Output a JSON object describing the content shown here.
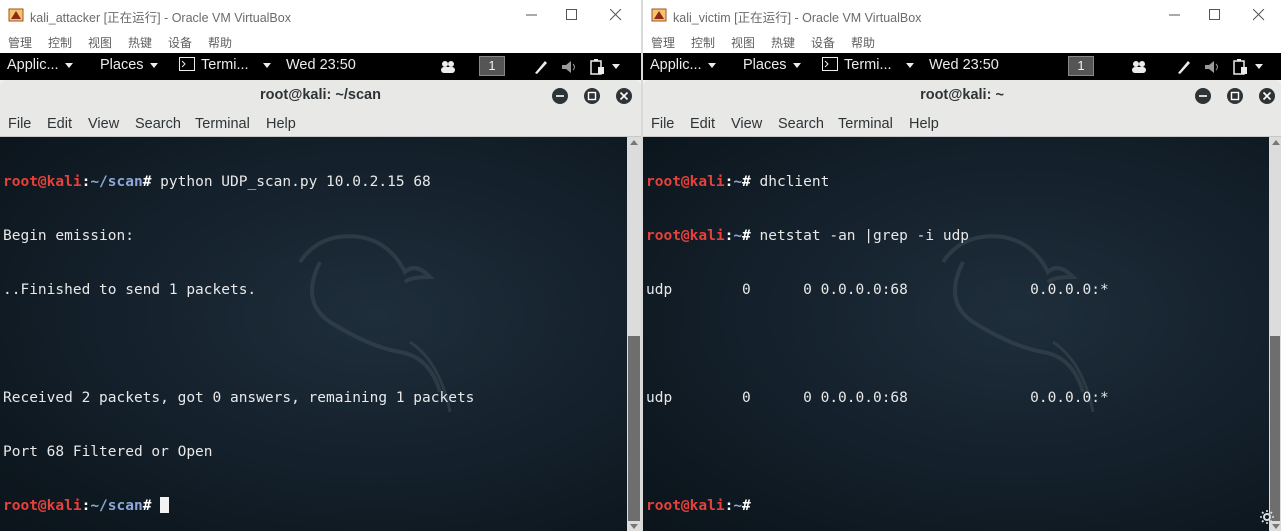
{
  "left": {
    "title": "kali_attacker [正在运行] - Oracle VM VirtualBox",
    "menu": [
      "管理",
      "控制",
      "视图",
      "热键",
      "设备",
      "帮助"
    ],
    "gnome": {
      "applications": "Applic...",
      "places": "Places",
      "terminal": "Termi...",
      "clock": "Wed 23:50",
      "workspace": "1"
    },
    "terminal_title": "root@kali: ~/scan",
    "terminal_menu": [
      "File",
      "Edit",
      "View",
      "Search",
      "Terminal",
      "Help"
    ],
    "lines": [
      {
        "user": "root@kali",
        "path": "~/scan",
        "cmd": " python UDP_scan.py 10.0.2.15 68"
      },
      {
        "text": "Begin emission:"
      },
      {
        "text": "..Finished to send 1 packets."
      },
      {
        "text": ""
      },
      {
        "text": "Received 2 packets, got 0 answers, remaining 1 packets"
      },
      {
        "text": "Port 68 Filtered or Open"
      },
      {
        "user": "root@kali",
        "path": "~/scan",
        "cmd": " ",
        "cursor": true
      }
    ]
  },
  "right": {
    "title": "kali_victim [正在运行] - Oracle VM VirtualBox",
    "menu": [
      "管理",
      "控制",
      "视图",
      "热键",
      "设备",
      "帮助"
    ],
    "gnome": {
      "applications": "Applic...",
      "places": "Places",
      "terminal": "Termi...",
      "clock": "Wed 23:50",
      "workspace": "1"
    },
    "terminal_title": "root@kali: ~",
    "terminal_menu": [
      "File",
      "Edit",
      "View",
      "Search",
      "Terminal",
      "Help"
    ],
    "lines": [
      {
        "user": "root@kali",
        "path": "~",
        "cmd": " dhclient"
      },
      {
        "user": "root@kali",
        "path": "~",
        "cmd": " netstat -an |grep -i udp"
      },
      {
        "text": "udp        0      0 0.0.0.0:68              0.0.0.0:*"
      },
      {
        "text": ""
      },
      {
        "text": "udp        0      0 0.0.0.0:68              0.0.0.0:*"
      },
      {
        "text": ""
      },
      {
        "user": "root@kali",
        "path": "~",
        "cmd": ""
      }
    ]
  },
  "colors": {
    "prompt_user": "#e8403b",
    "prompt_path": "#8da8d8",
    "terminal_bg": "#16232f",
    "gnome_bar": "#000000"
  },
  "icons": [
    "virtualbox-icon",
    "minimize-icon",
    "maximize-icon",
    "close-icon",
    "terminal-icon",
    "people-icon",
    "pencil-icon",
    "volume-icon",
    "battery-icon",
    "kali-dragon-icon"
  ]
}
